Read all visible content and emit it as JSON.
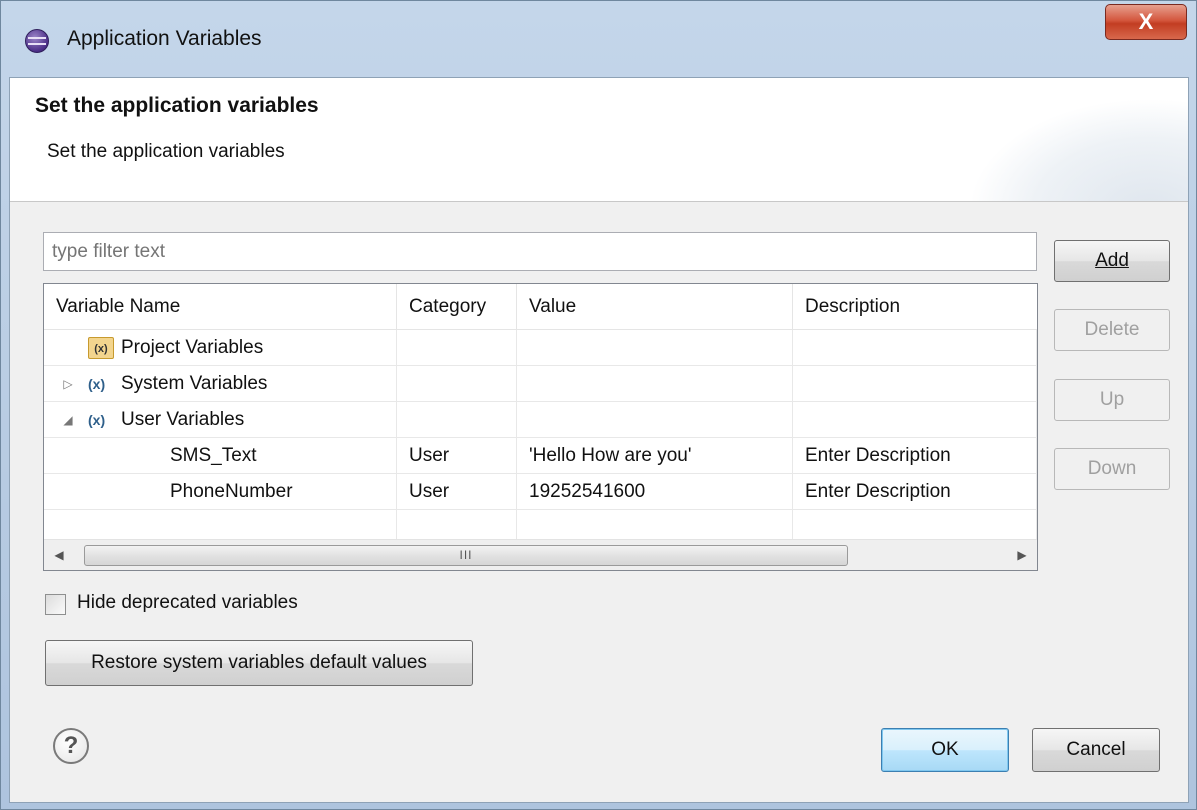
{
  "window": {
    "title": "Application Variables",
    "close_label": "X"
  },
  "header": {
    "title": "Set the application variables",
    "subtitle": "Set the application variables"
  },
  "filter": {
    "placeholder": "type filter text"
  },
  "buttons": {
    "add": "Add",
    "delete": "Delete",
    "up": "Up",
    "down": "Down",
    "restore": "Restore system variables default values",
    "ok": "OK",
    "cancel": "Cancel"
  },
  "table": {
    "columns": [
      "Variable Name",
      "Category",
      "Value",
      "Description"
    ],
    "tree": [
      {
        "label": "Project Variables",
        "icon": "project-variables-icon",
        "twisty": ""
      },
      {
        "label": "System Variables",
        "icon": "system-variables-icon",
        "twisty": "▷"
      },
      {
        "label": "User Variables",
        "icon": "user-variables-icon",
        "twisty": "◢"
      }
    ],
    "rows": [
      {
        "name": "SMS_Text",
        "category": "User",
        "value": "'Hello How are you'",
        "description": "Enter Description"
      },
      {
        "name": "PhoneNumber",
        "category": "User",
        "value": "19252541600",
        "description": "Enter Description"
      }
    ],
    "scrollbar": {
      "thumb_grip": "III",
      "left_arrow": "◀",
      "right_arrow": "▶"
    }
  },
  "options": {
    "hide_deprecated_label": "Hide deprecated variables",
    "hide_deprecated_checked": false
  },
  "help": {
    "glyph": "?"
  },
  "icons": {
    "folder_glyph": "(x)",
    "var_glyph": "(x)"
  }
}
